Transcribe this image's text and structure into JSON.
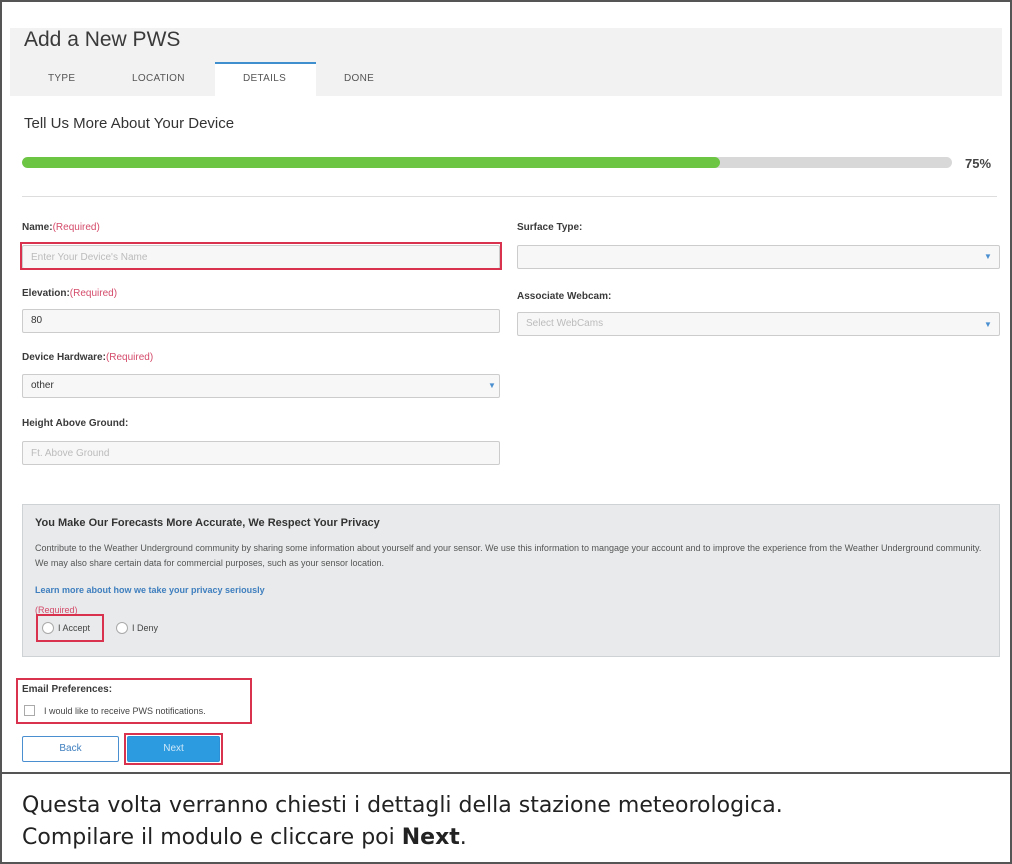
{
  "page": {
    "title": "Add a New PWS",
    "tabs": [
      {
        "label": "TYPE"
      },
      {
        "label": "LOCATION"
      },
      {
        "label": "DETAILS",
        "active": true
      },
      {
        "label": "DONE"
      }
    ],
    "section_title": "Tell Us More About Your Device",
    "progress": {
      "value": 75,
      "label": "75%"
    }
  },
  "form": {
    "name": {
      "label": "Name:",
      "required": "(Required)",
      "placeholder": "Enter Your Device's Name",
      "value": ""
    },
    "elevation": {
      "label": "Elevation:",
      "required": "(Required)",
      "value": "80"
    },
    "hardware": {
      "label": "Device Hardware:",
      "required": "(Required)",
      "value": "other"
    },
    "height": {
      "label": "Height Above Ground:",
      "placeholder": "Ft. Above Ground"
    },
    "surface": {
      "label": "Surface Type:",
      "value": ""
    },
    "webcam": {
      "label": "Associate Webcam:",
      "placeholder": "Select WebCams"
    }
  },
  "privacy": {
    "heading": "You Make Our Forecasts More Accurate, We Respect Your Privacy",
    "body": "Contribute to the Weather Underground community by sharing some information about yourself and your sensor. We use this information to mangage your account and to improve the experience from the Weather Underground community. We may also share certain data for commercial purposes, such as your sensor location.",
    "link": "Learn more about how we take your privacy seriously",
    "required": "(Required)",
    "accept": "I Accept",
    "deny": "I Deny"
  },
  "email": {
    "label": "Email Preferences:",
    "option": "I would like to receive PWS notifications."
  },
  "buttons": {
    "back": "Back",
    "next": "Next"
  },
  "caption": {
    "line1": "Questa volta verranno chiesti i dettagli della stazione meteorologica.",
    "line2_prefix": "Compilare il modulo e cliccare poi ",
    "line2_bold": "Next",
    "line2_suffix": "."
  },
  "colors": {
    "accent": "#2d9be0",
    "progress": "#6cc644",
    "required": "#d44b6b",
    "highlight": "#d9324f"
  }
}
